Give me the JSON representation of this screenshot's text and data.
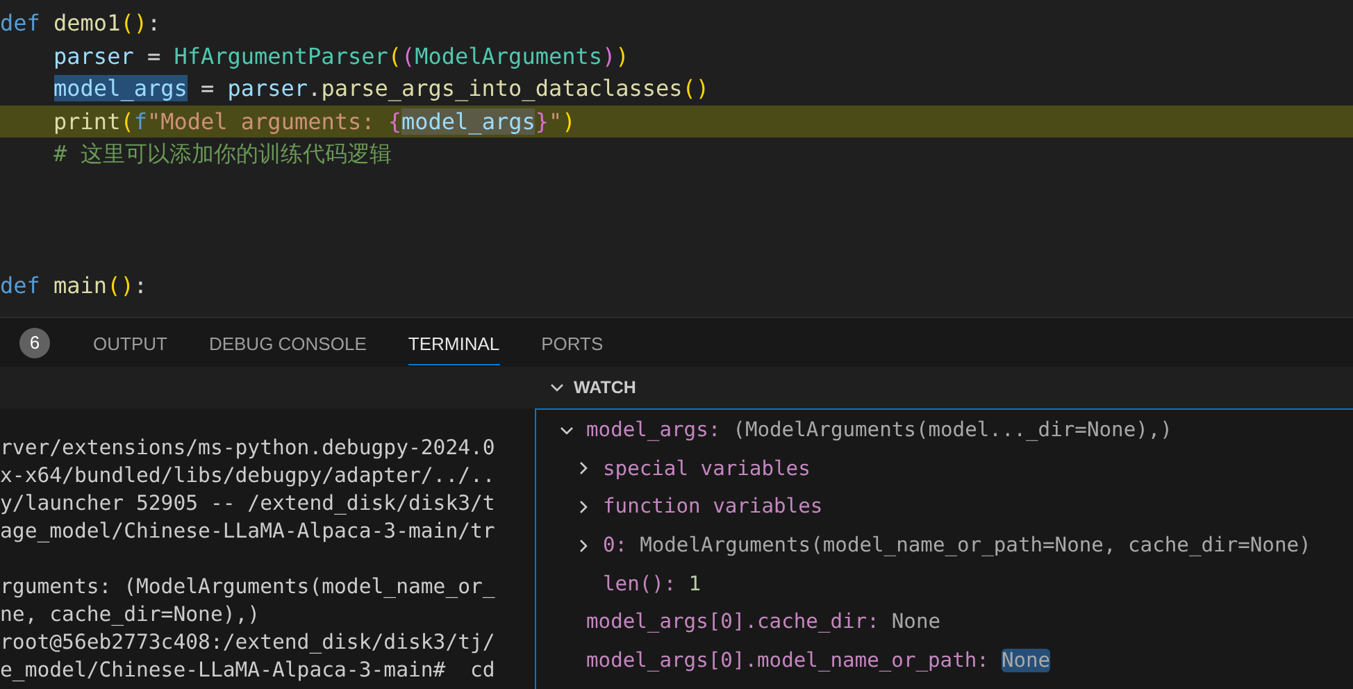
{
  "editor": {
    "lines": [
      {
        "current": false,
        "indented": false,
        "tokens": [
          {
            "kind": "keyword",
            "text": "def"
          },
          {
            "kind": "func",
            "text": "demo1"
          },
          {
            "kind": "bracket1",
            "text": "()"
          },
          {
            "kind": "plain",
            "text": ":"
          }
        ]
      },
      {
        "current": false,
        "indented": true,
        "tokens": [
          {
            "kind": "var",
            "text": "parser"
          },
          {
            "kind": "plain",
            "text": "="
          },
          {
            "kind": "class",
            "text": "HfArgumentParser"
          },
          {
            "kind": "bracket1",
            "text": "("
          },
          {
            "kind": "bracket2",
            "text": "("
          },
          {
            "kind": "class",
            "text": "ModelArguments"
          },
          {
            "kind": "bracket2",
            "text": ")"
          },
          {
            "kind": "bracket1",
            "text": ")"
          }
        ]
      },
      {
        "current": false,
        "indented": true,
        "tokens": [
          {
            "kind": "var",
            "text": "model_args",
            "selected": true
          },
          {
            "kind": "plain",
            "text": "="
          },
          {
            "kind": "var",
            "text": "parser"
          },
          {
            "kind": "plain",
            "text": "."
          },
          {
            "kind": "func",
            "text": "parse_args_into_dataclasses"
          },
          {
            "kind": "bracket1",
            "text": "()"
          }
        ]
      },
      {
        "current": true,
        "indented": true,
        "tokens": [
          {
            "kind": "func",
            "text": "print"
          },
          {
            "kind": "bracket1",
            "text": "("
          },
          {
            "kind": "keyword",
            "text": "f"
          },
          {
            "kind": "string",
            "text": "\"Model arguments:"
          },
          {
            "kind": "bracket2",
            "text": "{"
          },
          {
            "kind": "var",
            "text": "model_args",
            "match": true
          },
          {
            "kind": "bracket2",
            "text": "}"
          },
          {
            "kind": "string",
            "text": "\""
          },
          {
            "kind": "bracket1",
            "text": ")"
          }
        ]
      },
      {
        "current": false,
        "indented": true,
        "tokens": [
          {
            "kind": "comment",
            "text": "# 这里可以添加你的训练代码逻辑"
          }
        ]
      },
      {
        "current": false
      },
      {
        "current": false
      },
      {
        "current": false
      },
      {
        "current": false,
        "indented": false,
        "tokens": [
          {
            "kind": "keyword",
            "text": "def"
          },
          {
            "kind": "func",
            "text": "main"
          },
          {
            "kind": "bracket1",
            "text": "()"
          },
          {
            "kind": "plain",
            "text": ":"
          }
        ]
      }
    ]
  },
  "panel": {
    "badge": "6",
    "tabs": [
      {
        "label": "OUTPUT",
        "selected": false
      },
      {
        "label": "DEBUG CONSOLE",
        "selected": false
      },
      {
        "label": "TERMINAL",
        "selected": true
      },
      {
        "label": "PORTS",
        "selected": false
      }
    ]
  },
  "terminal": {
    "blocks": [
      [
        "rver/extensions/ms-python.debugpy-2024.0",
        "x-x64/bundled/libs/debugpy/adapter/../..",
        "y/launcher 52905 -- /extend_disk/disk3/t",
        "age_model/Chinese-LLaMA-Alpaca-3-main/tr"
      ],
      [
        "rguments: (ModelArguments(model_name_or_",
        "ne, cache_dir=None),)",
        "root@56eb2773c408:/extend_disk/disk3/tj/",
        "e_model/Chinese-LLaMA-Alpaca-3-main#  cd"
      ]
    ]
  },
  "watch": {
    "title": "WATCH",
    "expanded": true,
    "items": [
      {
        "name": "model_args:",
        "value": "(ModelArguments(model..._dir=None),)",
        "expanded": true,
        "children": [
          {
            "name": "special variables",
            "expanded": false
          },
          {
            "name": "function variables",
            "expanded": false
          },
          {
            "name": "0:",
            "value": "ModelArguments(model_name_or_path=None, cache_dir=None)",
            "expanded": false
          },
          {
            "name": "len():",
            "value": "1",
            "kind": "number"
          }
        ]
      },
      {
        "name": "model_args[0].cache_dir:",
        "value": "None",
        "highlight": false
      },
      {
        "name": "model_args[0].model_name_or_path:",
        "value": "None",
        "highlight": true
      }
    ]
  }
}
